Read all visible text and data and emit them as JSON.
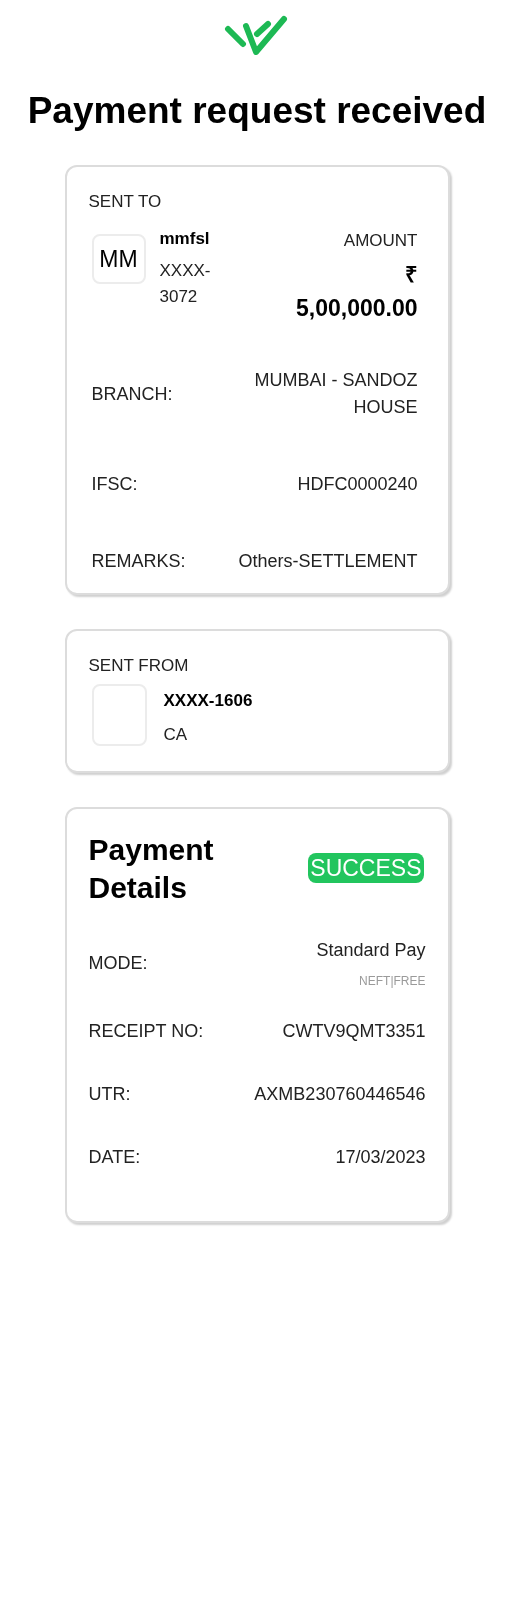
{
  "title": "Payment request received",
  "sent_to": {
    "label": "SENT TO",
    "avatar": "MM",
    "name": "mmfsl",
    "account": "XXXX-3072",
    "amount_label": "AMOUNT",
    "currency": "₹",
    "amount": "5,00,000.00",
    "rows": [
      {
        "label": "BRANCH:",
        "value": "MUMBAI - SANDOZ HOUSE"
      },
      {
        "label": "IFSC:",
        "value": "HDFC0000240"
      },
      {
        "label": "REMARKS:",
        "value": "Others-SETTLEMENT"
      }
    ]
  },
  "sent_from": {
    "label": "SENT FROM",
    "account": "XXXX-1606",
    "type": "CA"
  },
  "payment_details": {
    "title": "Payment Details",
    "status": {
      "label": "SUCCESS",
      "kind": "success"
    },
    "rows": [
      {
        "label": "MODE:",
        "value": "Standard Pay",
        "note": "NEFT|FREE"
      },
      {
        "label": "RECEIPT NO:",
        "value": "CWTV9QMT3351"
      },
      {
        "label": "UTR:",
        "value": "AXMB230760446546"
      },
      {
        "label": "DATE:",
        "value": "17/03/2023"
      }
    ]
  }
}
